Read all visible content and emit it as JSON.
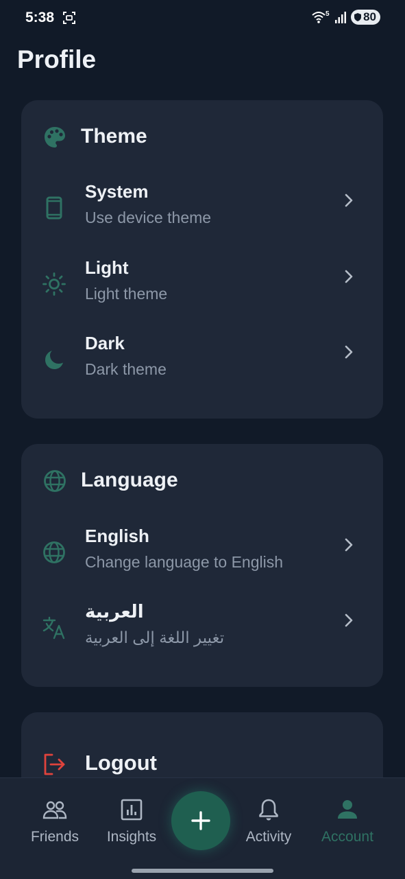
{
  "status_bar": {
    "time": "5:38",
    "network_badge": "5",
    "battery": "80"
  },
  "page": {
    "title": "Profile"
  },
  "theme_section": {
    "title": "Theme",
    "icon": "palette-icon",
    "items": [
      {
        "title": "System",
        "subtitle": "Use device theme",
        "icon": "smartphone-icon"
      },
      {
        "title": "Light",
        "subtitle": "Light theme",
        "icon": "sun-icon"
      },
      {
        "title": "Dark",
        "subtitle": "Dark theme",
        "icon": "moon-icon"
      }
    ]
  },
  "language_section": {
    "title": "Language",
    "icon": "globe-icon",
    "items": [
      {
        "title": "English",
        "subtitle": "Change language to English",
        "icon": "globe-icon"
      },
      {
        "title": "العربية",
        "subtitle": "تغيير اللغة إلى العربية",
        "icon": "translate-icon"
      }
    ]
  },
  "logout": {
    "label": "Logout",
    "icon": "logout-icon"
  },
  "bottom_nav": {
    "items": [
      {
        "label": "Friends",
        "icon": "people-icon"
      },
      {
        "label": "Insights",
        "icon": "chart-icon"
      },
      {
        "label": "Activity",
        "icon": "bell-icon"
      },
      {
        "label": "Account",
        "icon": "person-icon"
      }
    ],
    "active": "Account",
    "fab_icon": "plus-icon"
  },
  "colors": {
    "background": "#111a28",
    "card": "#1f2838",
    "accent": "#2f7263",
    "subtitle": "#8d98a8",
    "logout": "#e0433c",
    "fab": "#1f5f50"
  }
}
